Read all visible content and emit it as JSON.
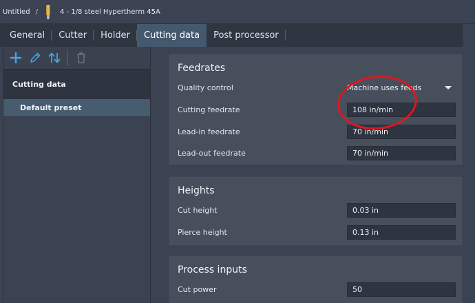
{
  "breadcrumb": {
    "document": "Untitled",
    "separator": "/",
    "tool_name": "4 - 1/8 steel Hypertherm 45A"
  },
  "tabs": [
    {
      "label": "General",
      "active": false
    },
    {
      "label": "Cutter",
      "active": false
    },
    {
      "label": "Holder",
      "active": false
    },
    {
      "label": "Cutting data",
      "active": true
    },
    {
      "label": "Post processor",
      "active": false
    }
  ],
  "toolbar": {
    "icons": [
      "plus-icon",
      "pencil-icon",
      "sort-arrows-icon",
      "trash-icon"
    ]
  },
  "preset_list": {
    "header": "Cutting data",
    "items": [
      {
        "label": "Default preset",
        "selected": true
      }
    ]
  },
  "feedrates": {
    "title": "Feedrates",
    "quality_control_label": "Quality control",
    "quality_control_value": "Machine uses feeds",
    "cutting_feedrate_label": "Cutting feedrate",
    "cutting_feedrate_value": "108 in/min",
    "lead_in_label": "Lead-in feedrate",
    "lead_in_value": "70 in/min",
    "lead_out_label": "Lead-out feedrate",
    "lead_out_value": "70 in/min"
  },
  "heights": {
    "title": "Heights",
    "cut_height_label": "Cut height",
    "cut_height_value": "0.03 in",
    "pierce_height_label": "Pierce height",
    "pierce_height_value": "0.13 in"
  },
  "process_inputs": {
    "title": "Process inputs",
    "cut_power_label": "Cut power",
    "cut_power_value": "50"
  },
  "colors": {
    "accent": "#4aa3e0",
    "annotation": "#e0161e",
    "active_tab": "#45596e"
  }
}
